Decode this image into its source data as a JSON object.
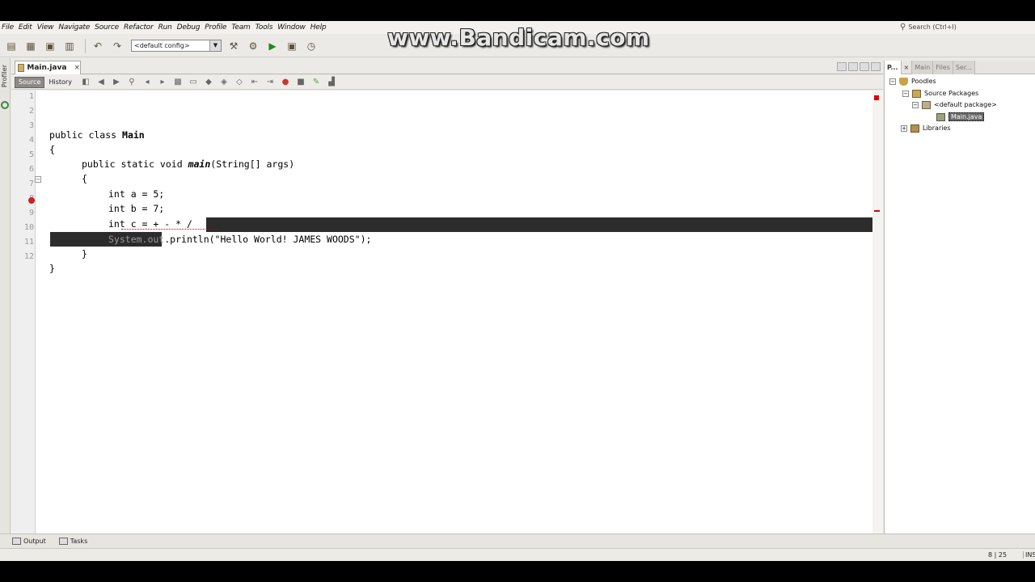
{
  "watermark": "www.Bandicam.com",
  "menu": [
    "File",
    "Edit",
    "View",
    "Navigate",
    "Source",
    "Refactor",
    "Run",
    "Debug",
    "Profile",
    "Team",
    "Tools",
    "Window",
    "Help"
  ],
  "search": {
    "placeholder": "Search (Ctrl+I)"
  },
  "toolbar": {
    "config": "<default config>"
  },
  "left_strip": {
    "label": "Profiler"
  },
  "editor_tab": {
    "filename": "Main.java",
    "close": "×"
  },
  "source_bar": {
    "source": "Source",
    "history": "History"
  },
  "code": {
    "line_numbers": [
      "1",
      "2",
      "3",
      "4",
      "5",
      "6",
      "7",
      "8",
      "9",
      "10",
      "11",
      "12"
    ],
    "l2_a": "public class ",
    "l2_b": "Main",
    "l3": "{",
    "l4_a": "public static void ",
    "l4_b": "main",
    "l4_c": "(String[] args)",
    "l5": "{",
    "l6": "int a = 5;",
    "l7": "int b = 7;",
    "l8": "int c = + - * /",
    "l9_a": "System.out",
    "l9_b": ".println(\"Hello World! JAMES WOODS\");",
    "l10": "}",
    "l11": "}"
  },
  "projects": {
    "tabs": [
      "P...",
      "Main",
      "Files",
      "Ser..."
    ],
    "root": "Poodles",
    "source_packages": "Source Packages",
    "default_package": "<default package>",
    "main_file": "Main.java",
    "libraries": "Libraries"
  },
  "output_tabs": {
    "output": "Output",
    "tasks": "Tasks"
  },
  "status": {
    "position": "8 | 25",
    "mode": "INS"
  }
}
